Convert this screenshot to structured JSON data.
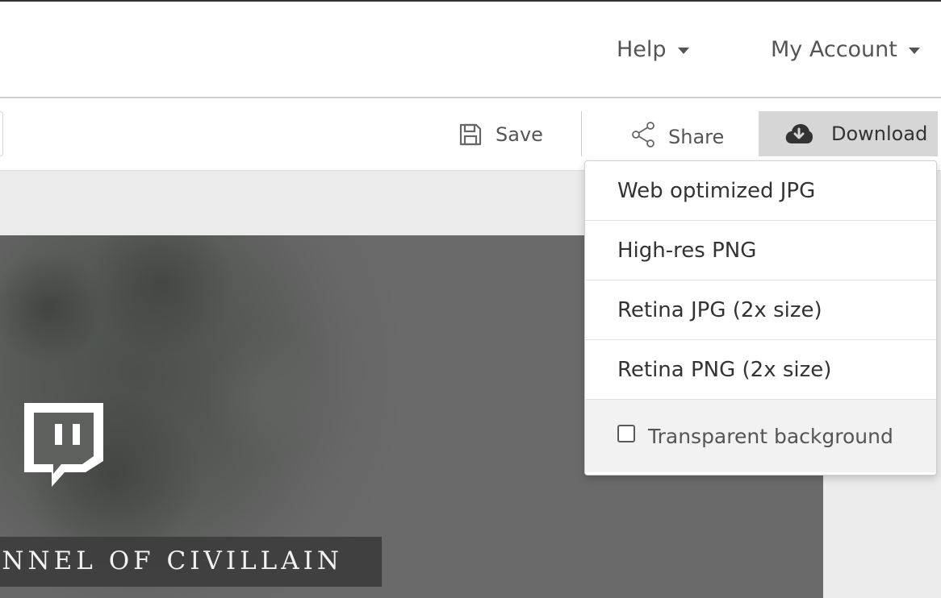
{
  "header": {
    "help_label": "Help",
    "account_label": "My Account"
  },
  "toolbar": {
    "save_label": "Save",
    "share_label": "Share",
    "download_label": "Download"
  },
  "download_menu": {
    "items": [
      {
        "label": "Web optimized JPG"
      },
      {
        "label": "High-res PNG"
      },
      {
        "label": "Retina JPG (2x size)"
      },
      {
        "label": "Retina PNG (2x size)"
      }
    ],
    "transparent_background": {
      "label": "Transparent background",
      "checked": false
    }
  },
  "design": {
    "banner_text": "ANNEL OF CIVILLAIN",
    "logo_icon": "twitch-icon"
  },
  "colors": {
    "download_button_bg": "#d6d6d6",
    "banner_bg": "#3c3c3c",
    "footer_bg": "#f2f2f2"
  }
}
